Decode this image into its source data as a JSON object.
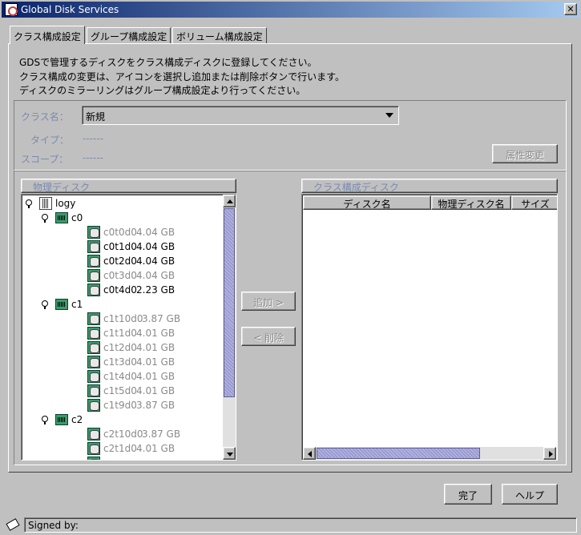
{
  "window": {
    "title": "Global Disk Services",
    "close_label": "✕"
  },
  "tabs": [
    {
      "label": "クラス構成設定",
      "active": true
    },
    {
      "label": "グループ構成設定",
      "active": false
    },
    {
      "label": "ボリューム構成設定",
      "active": false
    }
  ],
  "description": {
    "line1": "GDSで管理するディスクをクラス構成ディスクに登録してください。",
    "line2": "クラス構成の変更は、アイコンを選択し追加または削除ボタンで行います。",
    "line3": "ディスクのミラーリングはグループ構成設定より行ってください。"
  },
  "class_settings": {
    "class_name_label": "クラス名：",
    "class_name_value": "新規",
    "type_label": "タイプ：",
    "type_value": "------",
    "scope_label": "スコープ：",
    "scope_value": "------",
    "attribute_button": "属性変更"
  },
  "physical_disks": {
    "header": "物理ディスク",
    "tree": [
      {
        "kind": "host",
        "name": "logy"
      },
      {
        "kind": "controller",
        "name": "c0"
      },
      {
        "kind": "disk",
        "name": "c0t0d0",
        "size": "4.04 GB",
        "dim": true
      },
      {
        "kind": "disk",
        "name": "c0t1d0",
        "size": "4.04 GB",
        "dim": false
      },
      {
        "kind": "disk",
        "name": "c0t2d0",
        "size": "4.04 GB",
        "dim": false
      },
      {
        "kind": "disk",
        "name": "c0t3d0",
        "size": "4.04 GB",
        "dim": true
      },
      {
        "kind": "disk",
        "name": "c0t4d0",
        "size": "2.23 GB",
        "dim": false
      },
      {
        "kind": "controller",
        "name": "c1"
      },
      {
        "kind": "disk",
        "name": "c1t10d0",
        "size": "3.87 GB",
        "dim": true
      },
      {
        "kind": "disk",
        "name": "c1t1d0",
        "size": "4.01 GB",
        "dim": true
      },
      {
        "kind": "disk",
        "name": "c1t2d0",
        "size": "4.01 GB",
        "dim": true
      },
      {
        "kind": "disk",
        "name": "c1t3d0",
        "size": "4.01 GB",
        "dim": true
      },
      {
        "kind": "disk",
        "name": "c1t4d0",
        "size": "4.01 GB",
        "dim": true
      },
      {
        "kind": "disk",
        "name": "c1t5d0",
        "size": "4.01 GB",
        "dim": true
      },
      {
        "kind": "disk",
        "name": "c1t9d0",
        "size": "3.87 GB",
        "dim": true
      },
      {
        "kind": "controller",
        "name": "c2"
      },
      {
        "kind": "disk",
        "name": "c2t10d0",
        "size": "3.87 GB",
        "dim": true
      },
      {
        "kind": "disk",
        "name": "c2t1d0",
        "size": "4.01 GB",
        "dim": true
      },
      {
        "kind": "disk",
        "name": "",
        "size": "",
        "dim": true
      }
    ]
  },
  "actions": {
    "add": "追加 >",
    "remove": "< 削除"
  },
  "class_disks": {
    "header": "クラス構成ディスク",
    "columns": [
      "ディスク名",
      "物理ディスク名",
      "サイズ"
    ]
  },
  "footer": {
    "ok": "完了",
    "help": "ヘルプ"
  },
  "status": {
    "text": "Signed by:"
  }
}
